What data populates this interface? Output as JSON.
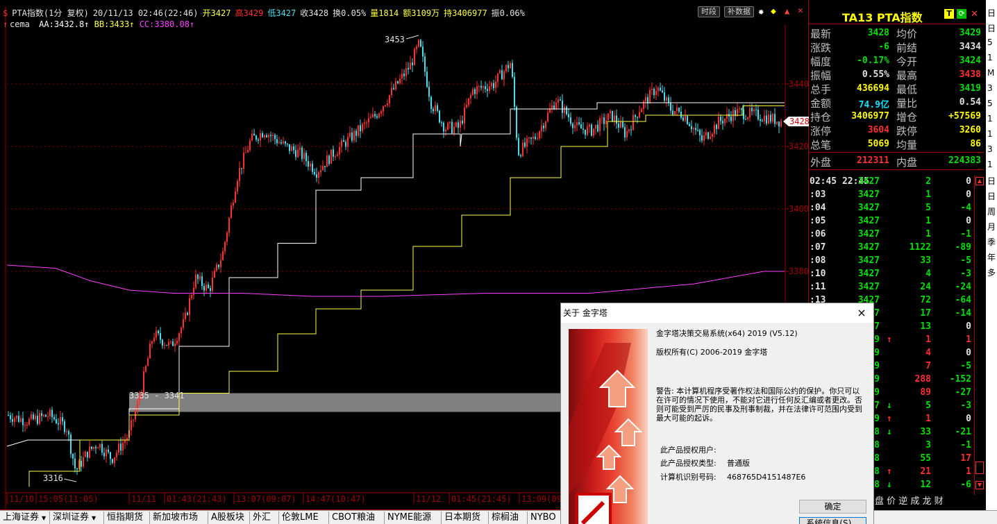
{
  "chart": {
    "header": {
      "symbol": "PTA指数(1分 复权)",
      "datetime": "20/11/13 02:46(22:46)",
      "open_label": "开3427",
      "high_label": "高3429",
      "low_label": "低3427",
      "close_label": "收3428",
      "turnover_label": "换0.05%",
      "volume_label": "量1814",
      "amount_label": "额3109万",
      "oi_label": "持3406977",
      "amplitude_label": "振0.06%"
    },
    "buttons": {
      "timeshare": "时段",
      "supplement": "补数据"
    },
    "indicator": {
      "name": "cema",
      "aa": "AA:3432.8",
      "bb": "BB:3433",
      "cc": "CC:3380.08"
    },
    "price_labels": {
      "p3453": "3453",
      "p3316": "3316",
      "range": "3335 - 3341",
      "current": "3428"
    },
    "y_ticks": [
      "3440",
      "3420",
      "3400",
      "3380"
    ],
    "x_ticks": [
      "11/10",
      "15:05(11:05)",
      "11/11",
      "01:43(21:43)",
      "13:07(09:07)",
      "14:47(10:47)",
      "11/12",
      "01:45(21:45)",
      "13:09(09"
    ],
    "colors": {
      "up": "#ff3030",
      "down": "#40e0f0",
      "aa": "#ffffff",
      "bb": "#ffff40",
      "cc": "#ff40ff",
      "grid": "#800000",
      "axis": "#a00000"
    }
  },
  "chart_data": {
    "type": "candlestick",
    "series": [
      {
        "name": "AA",
        "values": [
          3326,
          3326,
          3332,
          3332,
          3338,
          3338,
          3360,
          3360,
          3376,
          3376,
          3396,
          3396,
          3412,
          3412,
          3424,
          3424,
          3432,
          3432,
          3433,
          3433
        ]
      },
      {
        "name": "BB",
        "values": [
          3316,
          3318,
          3322,
          3328,
          3334,
          3342,
          3348,
          3358,
          3368,
          3374,
          3384,
          3394,
          3400,
          3410,
          3414,
          3418,
          3424,
          3428,
          3430,
          3433
        ]
      },
      {
        "name": "CC",
        "values": [
          3372,
          3370,
          3368,
          3364,
          3364,
          3363,
          3362,
          3362,
          3362,
          3362,
          3362,
          3363,
          3364,
          3365,
          3367,
          3368,
          3370,
          3374,
          3378,
          3380
        ]
      }
    ],
    "ylim": [
      3310,
      3458
    ],
    "annotations": [
      "3453",
      "3316",
      "3335 - 3341"
    ]
  },
  "quote": {
    "title": "TA13  PTA指数",
    "rows": [
      {
        "l1": "最新",
        "v1": "3428",
        "c1": "g",
        "l2": "均价",
        "v2": "3429",
        "c2": "g"
      },
      {
        "l1": "涨跌",
        "v1": "-6",
        "c1": "g",
        "l2": "前结",
        "v2": "3434",
        "c2": "w"
      },
      {
        "l1": "幅度",
        "v1": "-0.17%",
        "c1": "g",
        "l2": "今开",
        "v2": "3424",
        "c2": "g"
      },
      {
        "l1": "振幅",
        "v1": "0.55%",
        "c1": "w",
        "l2": "最高",
        "v2": "3438",
        "c2": "r"
      },
      {
        "l1": "总手",
        "v1": "436694",
        "c1": "y",
        "l2": "最低",
        "v2": "3419",
        "c2": "g"
      },
      {
        "l1": "金额",
        "v1": "74.9亿",
        "c1": "c",
        "l2": "量比",
        "v2": "0.54",
        "c2": "w"
      },
      {
        "l1": "持仓",
        "v1": "3406977",
        "c1": "y",
        "l2": "增仓",
        "v2": "+57569",
        "c2": "y"
      },
      {
        "l1": "涨停",
        "v1": "3604",
        "c1": "r",
        "l2": "跌停",
        "v2": "3260",
        "c2": "y"
      },
      {
        "l1": "总笔",
        "v1": "5069",
        "c1": "y",
        "l2": "均量",
        "v2": "86",
        "c2": "y"
      }
    ],
    "outer": {
      "l1": "外盘",
      "v1": "212311",
      "l2": "内盘",
      "v2": "224383"
    },
    "ticks": [
      {
        "t": "02:45 22:45",
        "p": "3427",
        "pc": "g",
        "arrow": "",
        "ac": "",
        "v": "2",
        "vc": "g",
        "d": "0",
        "dc": "w"
      },
      {
        "t": ":03",
        "p": "3427",
        "pc": "g",
        "arrow": "",
        "ac": "",
        "v": "1",
        "vc": "g",
        "d": "0",
        "dc": "w"
      },
      {
        "t": ":04",
        "p": "3427",
        "pc": "g",
        "arrow": "",
        "ac": "",
        "v": "5",
        "vc": "g",
        "d": "-4",
        "dc": "g"
      },
      {
        "t": ":05",
        "p": "3427",
        "pc": "g",
        "arrow": "",
        "ac": "",
        "v": "1",
        "vc": "g",
        "d": "0",
        "dc": "w"
      },
      {
        "t": ":06",
        "p": "3427",
        "pc": "g",
        "arrow": "",
        "ac": "",
        "v": "1",
        "vc": "g",
        "d": "-1",
        "dc": "g"
      },
      {
        "t": ":07",
        "p": "3427",
        "pc": "g",
        "arrow": "",
        "ac": "",
        "v": "1122",
        "vc": "g",
        "d": "-89",
        "dc": "g"
      },
      {
        "t": ":08",
        "p": "3427",
        "pc": "g",
        "arrow": "",
        "ac": "",
        "v": "33",
        "vc": "g",
        "d": "-5",
        "dc": "g"
      },
      {
        "t": ":10",
        "p": "3427",
        "pc": "g",
        "arrow": "",
        "ac": "",
        "v": "4",
        "vc": "g",
        "d": "-3",
        "dc": "g"
      },
      {
        "t": ":11",
        "p": "3427",
        "pc": "g",
        "arrow": "",
        "ac": "",
        "v": "24",
        "vc": "g",
        "d": "-24",
        "dc": "g"
      },
      {
        "t": ":13",
        "p": "3427",
        "pc": "g",
        "arrow": "",
        "ac": "",
        "v": "72",
        "vc": "g",
        "d": "-64",
        "dc": "g"
      },
      {
        "t": "",
        "p": "27",
        "pc": "g",
        "arrow": "",
        "ac": "",
        "v": "17",
        "vc": "g",
        "d": "-14",
        "dc": "g"
      },
      {
        "t": "",
        "p": "27",
        "pc": "g",
        "arrow": "",
        "ac": "",
        "v": "13",
        "vc": "g",
        "d": "0",
        "dc": "w"
      },
      {
        "t": "",
        "p": "29",
        "pc": "g",
        "arrow": "↑",
        "ac": "r",
        "v": "1",
        "vc": "r",
        "d": "1",
        "dc": "r"
      },
      {
        "t": "",
        "p": "29",
        "pc": "g",
        "arrow": "",
        "ac": "",
        "v": "4",
        "vc": "r",
        "d": "0",
        "dc": "w"
      },
      {
        "t": "",
        "p": "29",
        "pc": "g",
        "arrow": "",
        "ac": "",
        "v": "7",
        "vc": "r",
        "d": "-5",
        "dc": "g"
      },
      {
        "t": "",
        "p": "29",
        "pc": "g",
        "arrow": "",
        "ac": "",
        "v": "288",
        "vc": "r",
        "d": "-152",
        "dc": "g"
      },
      {
        "t": "",
        "p": "29",
        "pc": "g",
        "arrow": "",
        "ac": "",
        "v": "89",
        "vc": "r",
        "d": "-27",
        "dc": "g"
      },
      {
        "t": "",
        "p": "27",
        "pc": "g",
        "arrow": "↓",
        "ac": "g",
        "v": "5",
        "vc": "g",
        "d": "-3",
        "dc": "g"
      },
      {
        "t": "",
        "p": "29",
        "pc": "g",
        "arrow": "↑",
        "ac": "r",
        "v": "1",
        "vc": "r",
        "d": "0",
        "dc": "w"
      },
      {
        "t": "",
        "p": "28",
        "pc": "g",
        "arrow": "↓",
        "ac": "g",
        "v": "33",
        "vc": "g",
        "d": "-21",
        "dc": "g"
      },
      {
        "t": "",
        "p": "28",
        "pc": "g",
        "arrow": "",
        "ac": "",
        "v": "3",
        "vc": "g",
        "d": "-1",
        "dc": "g"
      },
      {
        "t": "",
        "p": "28",
        "pc": "g",
        "arrow": "",
        "ac": "",
        "v": "55",
        "vc": "g",
        "d": "17",
        "dc": "r"
      },
      {
        "t": "",
        "p": "28",
        "pc": "g",
        "arrow": "↑",
        "ac": "r",
        "v": "21",
        "vc": "r",
        "d": "1",
        "dc": "r"
      },
      {
        "t": "",
        "p": "28",
        "pc": "g",
        "arrow": "↓",
        "ac": "g",
        "v": "12",
        "vc": "g",
        "d": "-6",
        "dc": "g"
      }
    ],
    "bottom_tabs": "盘 价 逆 成 龙 财"
  },
  "tabs": [
    "上海证券",
    "深圳证券",
    "恒指期货",
    "新加坡市场",
    "A股板块",
    "外汇",
    "伦敦LME",
    "CBOT粮油",
    "NYME能源",
    "日本期货",
    "棕榈油",
    "NYBO"
  ],
  "edge_chars": [
    "日",
    "日",
    "5",
    "1",
    "M",
    "3",
    "5",
    "1",
    "1",
    "3",
    "1",
    "日",
    "日",
    "周",
    "月",
    "季",
    "年",
    "多"
  ],
  "dialog": {
    "title": "关于 金字塔",
    "close": "×",
    "line1": "金字塔决策交易系统(x64) 2019 (V5.12)",
    "line2": "版权所有(C) 2006-2019 金字塔",
    "warning": "警告: 本计算机程序受著作权法和国际公约的保护。你只可以在许可的情况下使用，不能对它进行任何反汇编或者更改。否则可能受到严厉的民事及刑事制裁，并在法律许可范围内受到最大可能的起诉。",
    "user_label": "此产品授权用户:",
    "type_label": "此产品授权类型:",
    "type_value": "普通版",
    "id_label": "计算机识别号码:",
    "id_value": "468765D4151487E6",
    "ok": "确定",
    "sysinfo": "系统信息(S)..."
  }
}
